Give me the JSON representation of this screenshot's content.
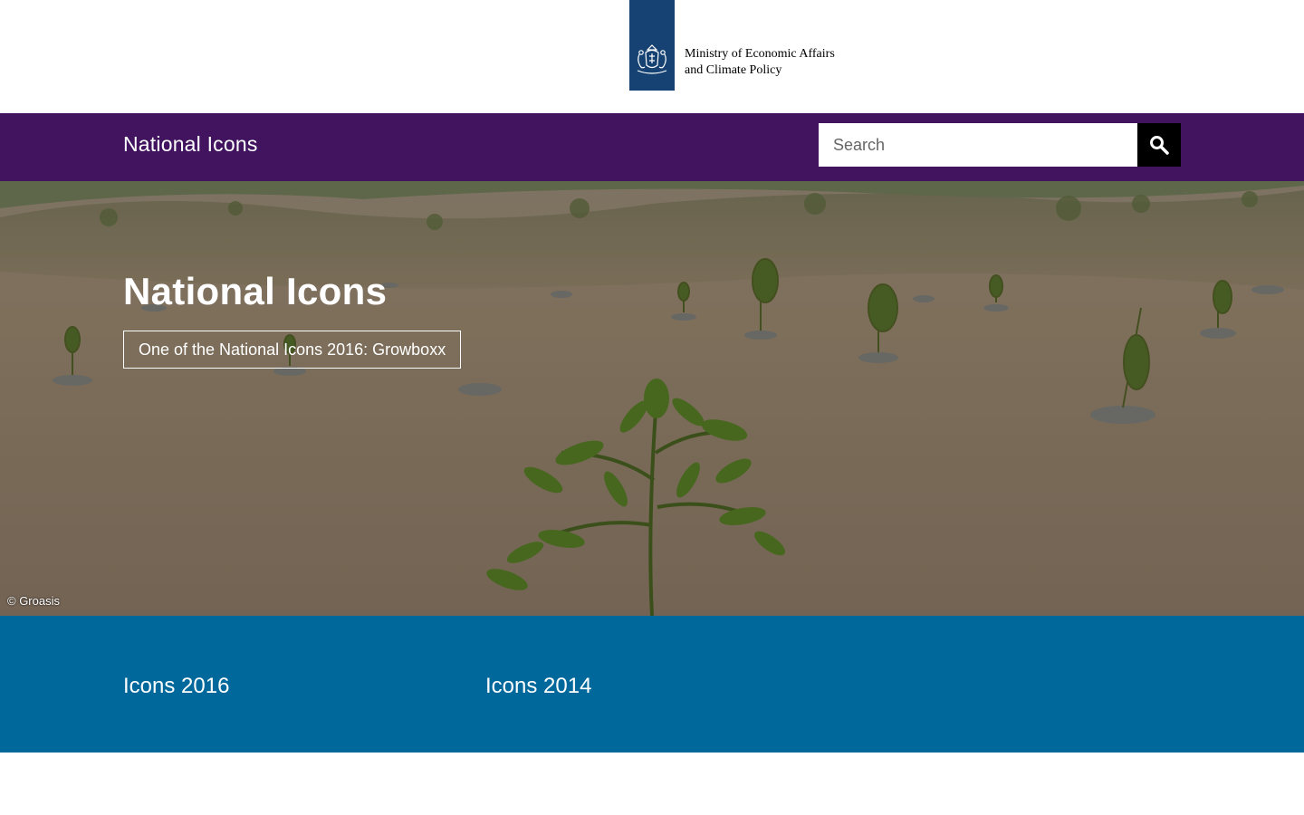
{
  "header": {
    "logo_icon": "coat-of-arms-icon",
    "logo_line1": "Ministry of Economic Affairs",
    "logo_line2": "and Climate Policy"
  },
  "navbar": {
    "site_title": "National Icons",
    "search": {
      "placeholder": "Search",
      "value": "",
      "button_icon": "search-icon"
    }
  },
  "hero": {
    "title": "National Icons",
    "link_label": "One of the National Icons 2016: Growboxx",
    "credit": "© Groasis"
  },
  "icons_section": {
    "links": [
      {
        "label": "Icons 2016"
      },
      {
        "label": "Icons 2014"
      }
    ]
  },
  "colors": {
    "nav_purple": "#42145f",
    "logo_blue": "#154273",
    "section_blue": "#01689b",
    "search_button": "#000000"
  }
}
